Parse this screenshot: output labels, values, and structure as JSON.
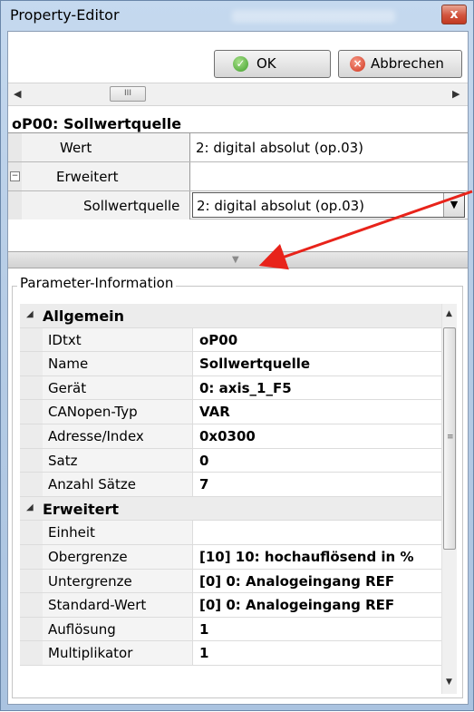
{
  "window": {
    "title": "Property-Editor",
    "close_glyph": "x"
  },
  "toolbar": {
    "ok_label": "OK",
    "cancel_label": "Abbrechen",
    "ok_icon": "check-circle-icon",
    "cancel_icon": "x-circle-icon"
  },
  "hscroll": {
    "thumb_glyph": "III"
  },
  "property": {
    "title": "oP00: Sollwertquelle",
    "rows": [
      {
        "label": "Wert",
        "value": "2: digital absolut (op.03)"
      },
      {
        "label": "Erweitert",
        "value": "",
        "expander": "−"
      },
      {
        "label": "Sollwertquelle",
        "value": "2: digital absolut (op.03)"
      }
    ]
  },
  "info": {
    "legend": "Parameter-Information",
    "categories": [
      {
        "name": "Allgemein",
        "rows": [
          {
            "label": "IDtxt",
            "value": "oP00"
          },
          {
            "label": "Name",
            "value": "Sollwertquelle"
          },
          {
            "label": "Gerät",
            "value": "0: axis_1_F5"
          },
          {
            "label": "CANopen-Typ",
            "value": "VAR"
          },
          {
            "label": "Adresse/Index",
            "value": "0x0300"
          },
          {
            "label": "Satz",
            "value": "0"
          },
          {
            "label": "Anzahl Sätze",
            "value": "7"
          }
        ]
      },
      {
        "name": "Erweitert",
        "rows": [
          {
            "label": "Einheit",
            "value": ""
          },
          {
            "label": "Obergrenze",
            "value": "[10] 10: hochauflösend in %"
          },
          {
            "label": "Untergrenze",
            "value": "[0] 0: Analogeingang REF"
          },
          {
            "label": "Standard-Wert",
            "value": "[0] 0: Analogeingang REF"
          },
          {
            "label": "Auflösung",
            "value": "1"
          },
          {
            "label": "Multiplikator",
            "value": "1"
          }
        ]
      }
    ]
  },
  "colors": {
    "annotation_arrow": "#e8231a",
    "window_frame": "#b7cde6"
  }
}
